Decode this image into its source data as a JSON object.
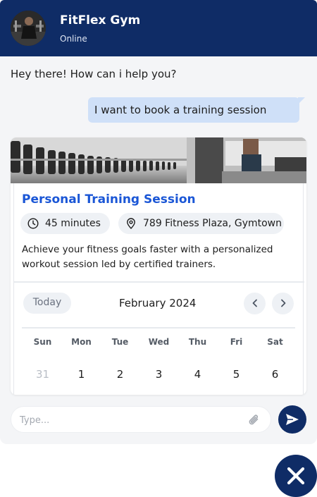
{
  "header": {
    "name": "FitFlex Gym",
    "status": "Online"
  },
  "messages": [
    {
      "from": "bot",
      "text": "Hey there! How can i help you?"
    },
    {
      "from": "user",
      "text": "I want to book a training session"
    }
  ],
  "service_card": {
    "title": "Personal Training Session",
    "duration": "45 minutes",
    "location": "789 Fitness Plaza, Gymtown",
    "description": "Achieve your fitness goals faster with a personalized workout session led by certified trainers."
  },
  "calendar": {
    "today_label": "Today",
    "month": "February 2024",
    "weekdays": [
      "Sun",
      "Mon",
      "Tue",
      "Wed",
      "Thu",
      "Fri",
      "Sat"
    ],
    "first_week": [
      "31",
      "1",
      "2",
      "3",
      "4",
      "5",
      "6"
    ]
  },
  "composer": {
    "placeholder": "Type..."
  },
  "colors": {
    "brand": "#0f2c66",
    "accent": "#1a56d6",
    "user_bubble": "#cfe0f8"
  },
  "icons": {
    "duration": "clock-icon",
    "location": "map-pin-icon",
    "prev": "chevron-left-icon",
    "next": "chevron-right-icon",
    "attach": "paperclip-icon",
    "send": "send-icon",
    "close": "close-icon"
  }
}
